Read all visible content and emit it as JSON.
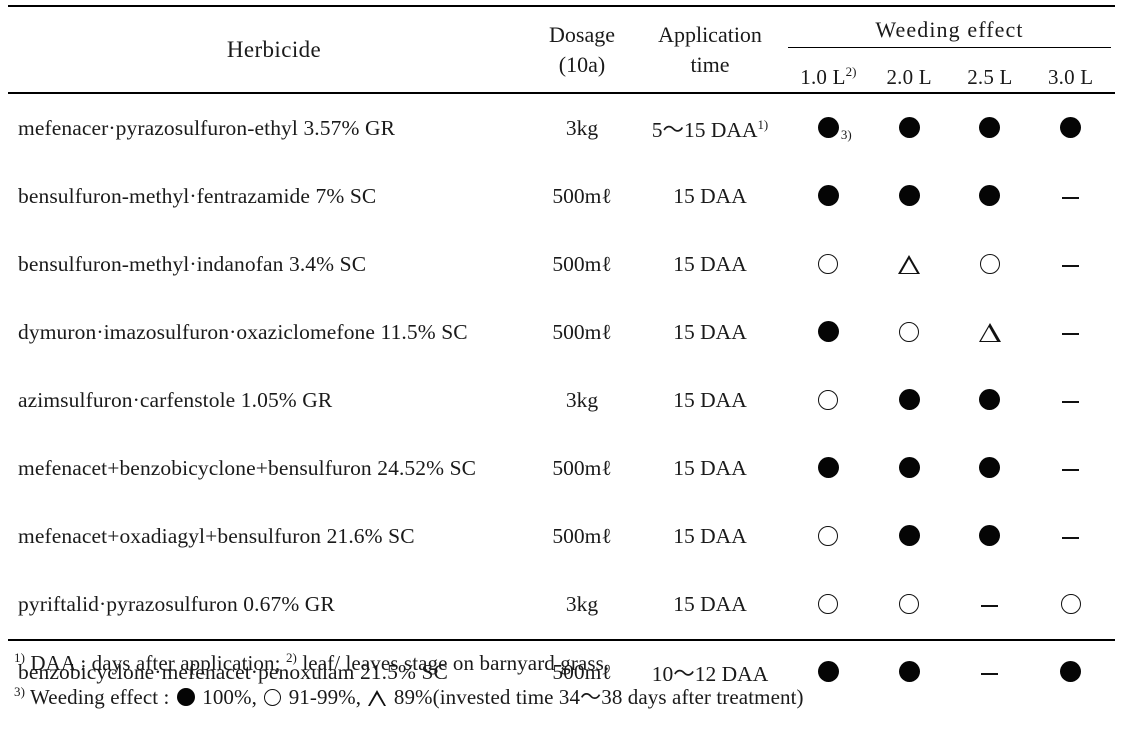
{
  "table": {
    "columns": {
      "herbicide": "Herbicide",
      "dosage_line1": "Dosage",
      "dosage_line2": "(10a)",
      "application_line1": "Application",
      "application_line2": "time",
      "weeding_effect": "Weeding effect",
      "rates": [
        {
          "label": "1.0 L",
          "footnote": "2)"
        },
        {
          "label": "2.0 L",
          "footnote": ""
        },
        {
          "label": "2.5 L",
          "footnote": ""
        },
        {
          "label": "3.0 L",
          "footnote": ""
        }
      ]
    },
    "rows": [
      {
        "herbicide": "mefenacer·pyrazosulfuron-ethyl 3.57%  GR",
        "dosage": "3kg",
        "application_time": "5～15 DAA",
        "application_footnote": "1)",
        "effects": [
          "filled",
          "filled",
          "filled",
          "filled"
        ],
        "first_effect_footnote": "3)"
      },
      {
        "herbicide": "bensulfuron-methyl·fentrazamide 7%  SC",
        "dosage": "500mℓ",
        "application_time": "15 DAA",
        "application_footnote": "",
        "effects": [
          "filled",
          "filled",
          "filled",
          "dash"
        ],
        "first_effect_footnote": ""
      },
      {
        "herbicide": "bensulfuron-methyl·indanofan 3.4%  SC",
        "dosage": "500mℓ",
        "application_time": "15 DAA",
        "application_footnote": "",
        "effects": [
          "open",
          "triangle",
          "open",
          "dash"
        ],
        "first_effect_footnote": ""
      },
      {
        "herbicide": "dymuron·imazosulfuron·oxaziclomefone 11.5%  SC",
        "dosage": "500mℓ",
        "application_time": "15 DAA",
        "application_footnote": "",
        "effects": [
          "filled",
          "open",
          "triangle",
          "dash"
        ],
        "first_effect_footnote": ""
      },
      {
        "herbicide": "azimsulfuron·carfenstole 1.05%  GR",
        "dosage": "3kg",
        "application_time": "15 DAA",
        "application_footnote": "",
        "effects": [
          "open",
          "filled",
          "filled",
          "dash"
        ],
        "first_effect_footnote": ""
      },
      {
        "herbicide": "mefenacet+benzobicyclone+bensulfuron 24.52%  SC",
        "dosage": "500mℓ",
        "application_time": "15 DAA",
        "application_footnote": "",
        "effects": [
          "filled",
          "filled",
          "filled",
          "dash"
        ],
        "first_effect_footnote": ""
      },
      {
        "herbicide": "mefenacet+oxadiagyl+bensulfuron 21.6%  SC",
        "dosage": "500mℓ",
        "application_time": "15 DAA",
        "application_footnote": "",
        "effects": [
          "open",
          "filled",
          "filled",
          "dash"
        ],
        "first_effect_footnote": ""
      },
      {
        "herbicide": "pyriftalid·pyrazosulfuron 0.67%  GR",
        "dosage": "3kg",
        "application_time": "15 DAA",
        "application_footnote": "",
        "effects": [
          "open",
          "open",
          "dash",
          "open"
        ],
        "first_effect_footnote": ""
      },
      {
        "herbicide": "benzobicyclone·mefenacet·penoxulam 21.5%  SC",
        "dosage": "500mℓ",
        "application_time": "10～12 DAA",
        "application_footnote": "",
        "effects": [
          "filled",
          "filled",
          "dash",
          "filled"
        ],
        "first_effect_footnote": ""
      }
    ]
  },
  "footnotes": {
    "line1_marker_a": "1)",
    "line1_text_a": "DAA : days after application;",
    "line1_marker_b": "2)",
    "line1_text_b": "leaf/ leaves stage on barnyard grass.",
    "line2_marker": "3)",
    "line2_prefix": "Weeding effect :",
    "line2_filled_text": "100%,",
    "line2_open_text": "91-99%,",
    "line2_triangle_text": "89%(invested time 34～38 days after treatment)"
  },
  "colors": {
    "ink": "#1a1a1a",
    "rule": "#000000",
    "background": "#ffffff"
  }
}
